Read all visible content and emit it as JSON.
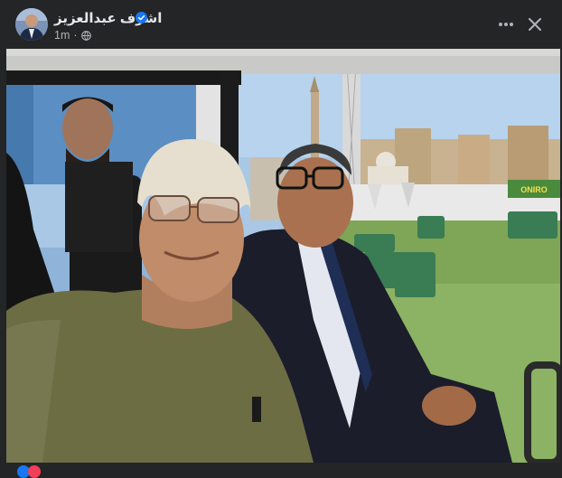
{
  "post": {
    "author": "اشرف عبدالعزيز",
    "verified": true,
    "time": "1m",
    "audience_icon": "globe-icon"
  },
  "photo": {
    "description_icon": "photo",
    "banner_text": "ONIRO"
  },
  "reactions": {
    "icons": [
      "like-icon",
      "love-icon"
    ]
  },
  "colors": {
    "background": "#242526",
    "text_primary": "#e4e6eb",
    "text_secondary": "#b0b3b8",
    "verified_blue": "#1877f2"
  }
}
